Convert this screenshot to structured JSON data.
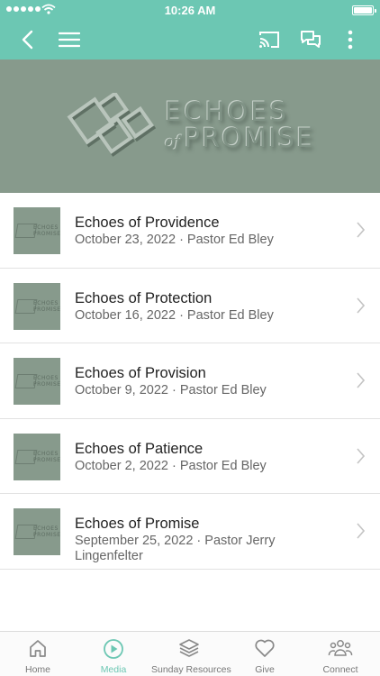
{
  "status_bar": {
    "time": "10:26 AM"
  },
  "colors": {
    "accent": "#6cc7b3",
    "banner": "#879a8c"
  },
  "top_bar": {
    "icons": [
      "back-icon",
      "menu-icon",
      "cast-icon",
      "chat-icon",
      "more-vertical-icon"
    ]
  },
  "banner": {
    "title_line1": "ECHOES",
    "title_of": "of",
    "title_line2": "PROMISE"
  },
  "sermons": [
    {
      "title": "Echoes of Providence",
      "subtitle": "October 23, 2022 · Pastor Ed Bley"
    },
    {
      "title": "Echoes of Protection",
      "subtitle": "October 16, 2022 · Pastor Ed Bley"
    },
    {
      "title": "Echoes of Provision",
      "subtitle": "October 9, 2022 · Pastor Ed Bley"
    },
    {
      "title": "Echoes of Patience",
      "subtitle": "October 2, 2022 · Pastor Ed Bley"
    },
    {
      "title": "Echoes of Promise",
      "subtitle": "September 25, 2022 · Pastor Jerry Lingenfelter"
    }
  ],
  "tabs": [
    {
      "label": "Home",
      "icon": "home-icon",
      "active": false
    },
    {
      "label": "Media",
      "icon": "play-circle-icon",
      "active": true
    },
    {
      "label": "Sunday Resources",
      "icon": "layers-icon",
      "active": false
    },
    {
      "label": "Give",
      "icon": "heart-icon",
      "active": false
    },
    {
      "label": "Connect",
      "icon": "people-icon",
      "active": false
    }
  ]
}
